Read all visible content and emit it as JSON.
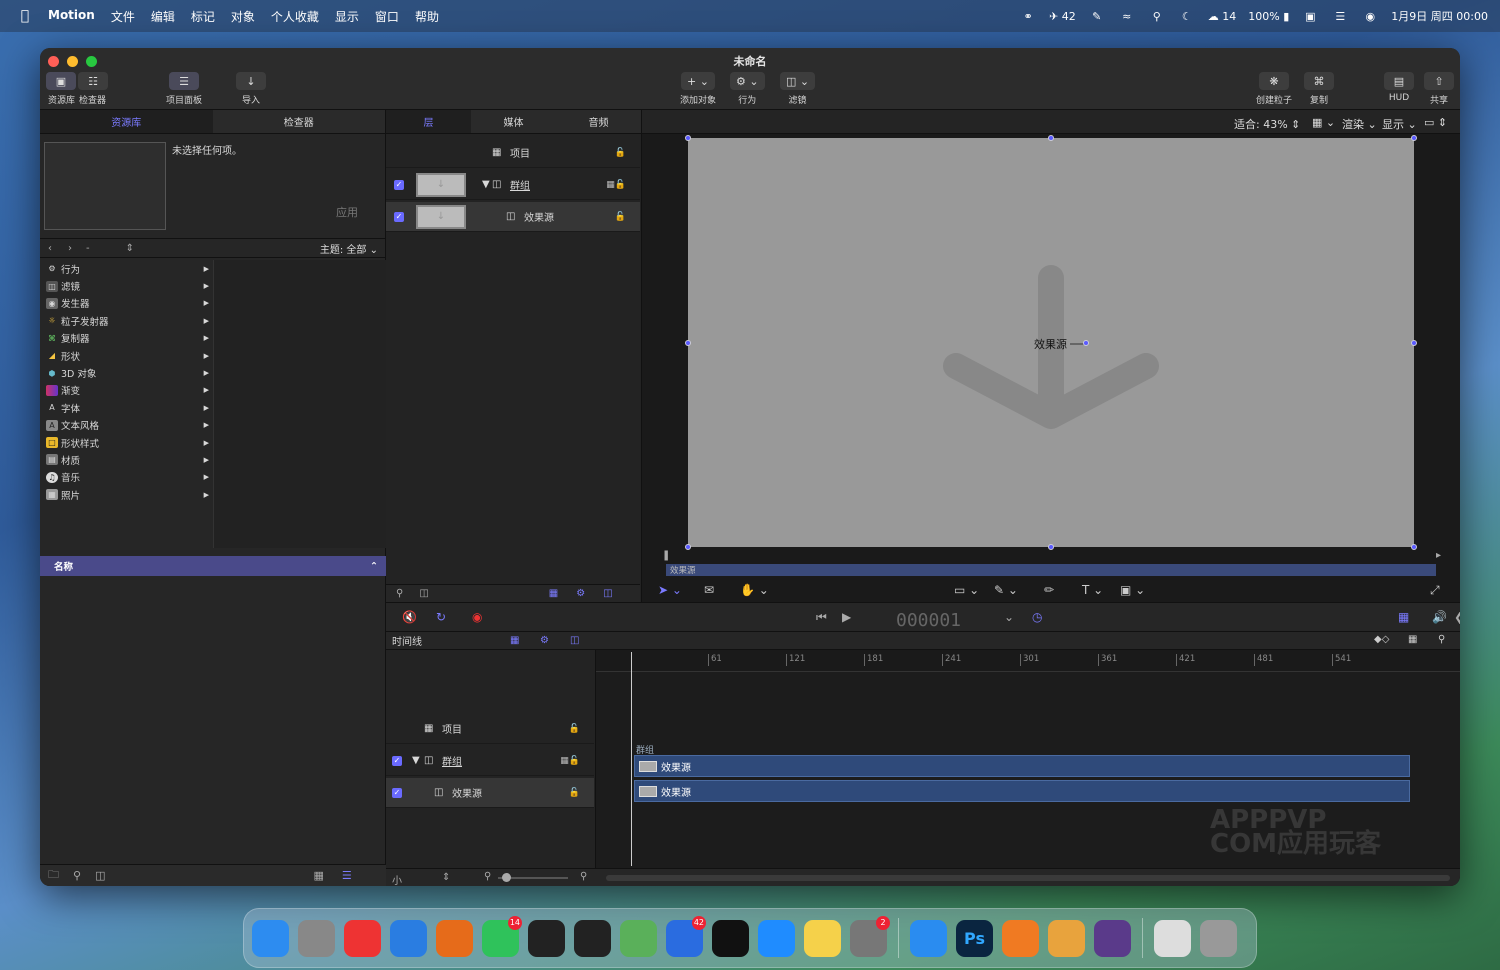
{
  "menubar": {
    "app_name": "Motion",
    "items": [
      "文件",
      "编辑",
      "标记",
      "对象",
      "个人收藏",
      "显示",
      "窗口",
      "帮助"
    ],
    "status": {
      "notif_count": "42",
      "wechat_count": "14",
      "battery": "100%",
      "datetime": "1月9日 周四 00:00"
    }
  },
  "window": {
    "title": "未命名",
    "toolbar": {
      "library": "资源库",
      "inspector": "检查器",
      "project_panel": "项目面板",
      "import": "导入",
      "add_object": "添加对象",
      "behaviors": "行为",
      "filters": "滤镜",
      "create_particles": "创建粒子",
      "replicate": "复制",
      "hud": "HUD",
      "share": "共享"
    }
  },
  "library_panel": {
    "tabs": [
      "资源库",
      "检查器"
    ],
    "no_selection": "未选择任何项。",
    "apply": "应用",
    "theme": "主题: 全部",
    "categories": [
      {
        "label": "行为",
        "icon": "gear-icon"
      },
      {
        "label": "滤镜",
        "icon": "filter-icon"
      },
      {
        "label": "发生器",
        "icon": "generator-icon"
      },
      {
        "label": "粒子发射器",
        "icon": "emitter-icon"
      },
      {
        "label": "复制器",
        "icon": "replicator-icon"
      },
      {
        "label": "形状",
        "icon": "shape-icon"
      },
      {
        "label": "3D 对象",
        "icon": "cube-icon"
      },
      {
        "label": "渐变",
        "icon": "gradient-icon"
      },
      {
        "label": "字体",
        "icon": "font-icon"
      },
      {
        "label": "文本风格",
        "icon": "text-style-icon"
      },
      {
        "label": "形状样式",
        "icon": "shape-style-icon"
      },
      {
        "label": "材质",
        "icon": "material-icon"
      },
      {
        "label": "音乐",
        "icon": "music-icon"
      },
      {
        "label": "照片",
        "icon": "photo-icon"
      }
    ],
    "name_header": "名称"
  },
  "layers_panel": {
    "tabs": [
      "层",
      "媒体",
      "音频"
    ],
    "rows": [
      {
        "label": "项目"
      },
      {
        "label": "群组"
      },
      {
        "label": "效果源"
      }
    ]
  },
  "viewer": {
    "fit_label": "适合:",
    "zoom": "43%",
    "render": "渲染",
    "view": "显示",
    "object_label": "效果源",
    "mini_timeline_label": "效果源"
  },
  "transport": {
    "timecode": "000001"
  },
  "timeline": {
    "header": "时间线",
    "rows": [
      {
        "label": "项目"
      },
      {
        "label": "群组"
      },
      {
        "label": "效果源"
      }
    ],
    "ruler_ticks": [
      "61",
      "121",
      "181",
      "241",
      "301",
      "361",
      "421",
      "481",
      "541"
    ],
    "group_label": "群组",
    "tracks": [
      "效果源",
      "效果源"
    ],
    "size_label": "小"
  },
  "watermark": {
    "line1": "APPPVP",
    "line2": "COM应用玩客"
  },
  "dock": {
    "apps": [
      {
        "name": "finder-icon",
        "color": "#2d8cf0",
        "badge": ""
      },
      {
        "name": "launchpad-icon",
        "color": "#888",
        "badge": ""
      },
      {
        "name": "chrome-icon",
        "color": "#e33",
        "badge": ""
      },
      {
        "name": "safari-icon",
        "color": "#2a7de1",
        "badge": ""
      },
      {
        "name": "firefox-icon",
        "color": "#e66b1a",
        "badge": ""
      },
      {
        "name": "wechat-icon",
        "color": "#2fc25b",
        "badge": "14"
      },
      {
        "name": "qq-icon",
        "color": "#222",
        "badge": ""
      },
      {
        "name": "qq-alt-icon",
        "color": "#222",
        "badge": ""
      },
      {
        "name": "mindnode-icon",
        "color": "#5ab05a",
        "badge": ""
      },
      {
        "name": "mail-icon",
        "color": "#2a6ce0",
        "badge": "42"
      },
      {
        "name": "capcut-icon",
        "color": "#111",
        "badge": ""
      },
      {
        "name": "lark-icon",
        "color": "#1f8cff",
        "badge": ""
      },
      {
        "name": "notes-icon",
        "color": "#f5d14a",
        "badge": ""
      },
      {
        "name": "settings-icon",
        "color": "#777",
        "badge": "2"
      },
      {
        "name": "baidu-netdisk-icon",
        "color": "#2a8cf0",
        "badge": ""
      },
      {
        "name": "photoshop-icon",
        "color": "#0a2540",
        "badge": ""
      },
      {
        "name": "appstore-alt-icon",
        "color": "#f07a22",
        "badge": ""
      },
      {
        "name": "pages-icon",
        "color": "#e8a33d",
        "badge": ""
      },
      {
        "name": "motion-icon",
        "color": "#5a3a8a",
        "badge": ""
      },
      {
        "name": "preview-icon",
        "color": "#ddd",
        "badge": ""
      },
      {
        "name": "trash-icon",
        "color": "#999",
        "badge": ""
      }
    ],
    "ps_label": "Ps"
  }
}
